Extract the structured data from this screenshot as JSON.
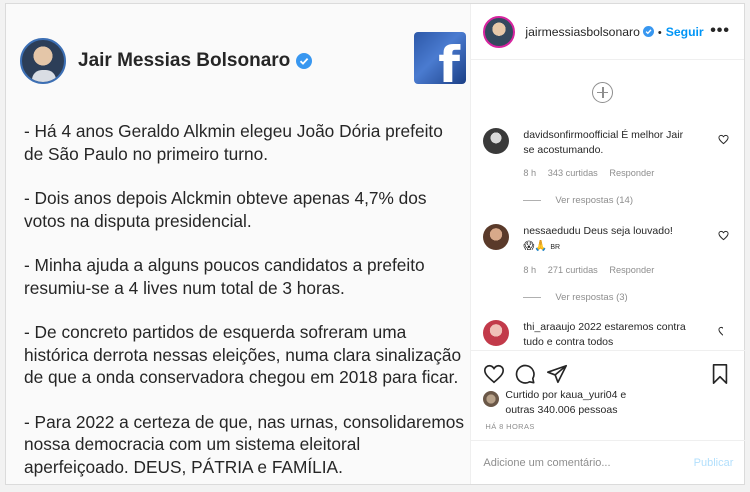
{
  "post": {
    "author": "Jair Messias Bolsonaro",
    "paragraphs": [
      "- Há 4 anos Geraldo Alkmin elegeu João Dória prefeito de São Paulo no primeiro turno.",
      "- Dois anos depois Alckmin obteve apenas 4,7% dos votos na disputa presidencial.",
      "- Minha ajuda a alguns poucos candidatos a prefeito resumiu-se a 4 lives num total de 3 horas.",
      "- De concreto partidos de esquerda sofreram uma histórica derrota nessas eleições, numa clara sinalização de que a onda conservadora chegou em 2018 para ficar.",
      "- Para 2022 a certeza de que, nas urnas, consolidaremos nossa democracia com um sistema eleitoral aperfeiçoado. DEUS, PÁTRIA e FAMÍLIA."
    ],
    "badge": "facebook-logo"
  },
  "header": {
    "username": "jairmessiasbolsonaro",
    "separator": "•",
    "follow_label": "Seguir",
    "more_label": "•••"
  },
  "comments": [
    {
      "username": "davidsonfirmoofficial",
      "text": "É melhor Jair se acostumando.",
      "time": "8 h",
      "likes": "343 curtidas",
      "reply_label": "Responder",
      "view_replies": "Ver respostas (14)"
    },
    {
      "username": "nessaedudu",
      "text": "Deus seja louvado!",
      "emoji": "😱🙏",
      "flag": "BR",
      "time": "8 h",
      "likes": "271 curtidas",
      "reply_label": "Responder",
      "view_replies": "Ver respostas (3)"
    },
    {
      "username": "thi_araaujo",
      "text": "2022 estaremos contra tudo e contra todos"
    }
  ],
  "liked_by": {
    "prefix": "Curtido por",
    "user": "kaua_yuri04",
    "connector": "e",
    "others": "outras 340.006 pessoas"
  },
  "time_ago": "HÁ 8 HORAS",
  "comment_box": {
    "placeholder": "Adicione um comentário...",
    "publish_label": "Publicar"
  },
  "colors": {
    "accent": "#0095f6",
    "verified": "#3897f0",
    "muted": "#8e8e8e",
    "text": "#262626"
  }
}
